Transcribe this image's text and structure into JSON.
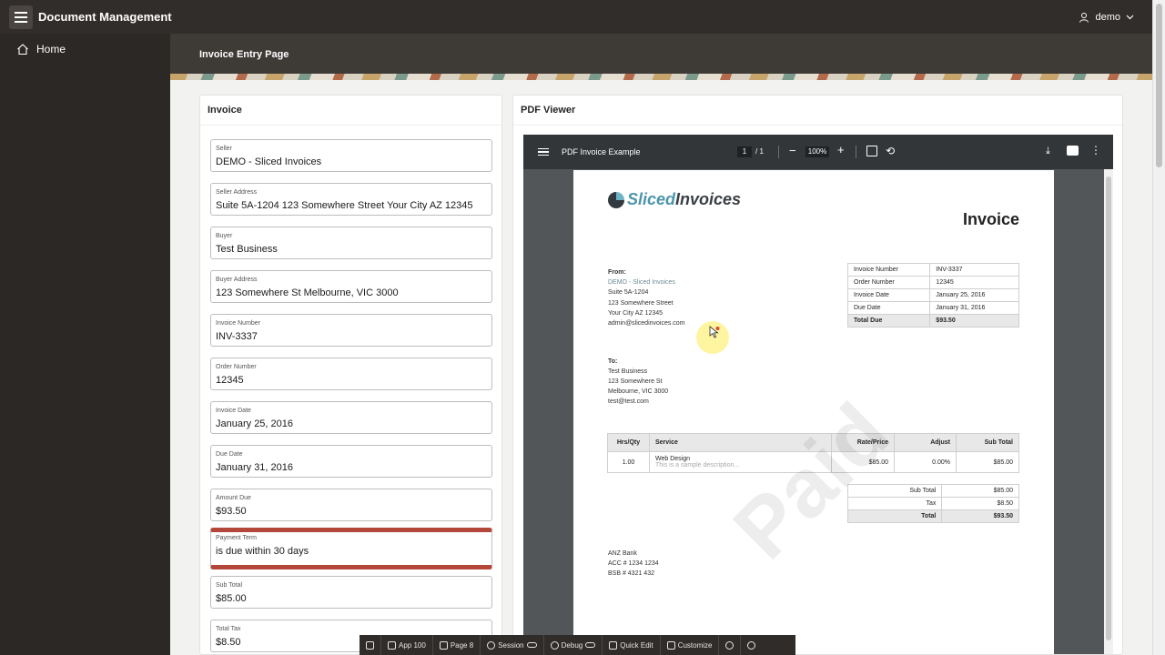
{
  "header": {
    "app_title": "Document Management",
    "user_name": "demo"
  },
  "sidebar": {
    "items": [
      {
        "label": "Home"
      }
    ]
  },
  "page": {
    "title": "Invoice Entry Page"
  },
  "invoice_region": {
    "title": "Invoice",
    "fields": [
      {
        "label": "Seller",
        "value": "DEMO - Sliced Invoices"
      },
      {
        "label": "Seller Address",
        "value": "Suite 5A-1204 123 Somewhere Street Your City AZ 12345"
      },
      {
        "label": "Buyer",
        "value": "Test Business"
      },
      {
        "label": "Buyer Address",
        "value": "123 Somewhere St Melbourne, VIC 3000"
      },
      {
        "label": "Invoice Number",
        "value": "INV-3337"
      },
      {
        "label": "Order Number",
        "value": "12345"
      },
      {
        "label": "Invoice Date",
        "value": "January 25, 2016"
      },
      {
        "label": "Due Date",
        "value": "January 31, 2016"
      },
      {
        "label": "Amount Due",
        "value": "$93.50"
      },
      {
        "label": "Payment Term",
        "value": "is due within 30 days"
      },
      {
        "label": "Sub Total",
        "value": "$85.00"
      },
      {
        "label": "Total Tax",
        "value": "$8.50"
      }
    ]
  },
  "pdf_region": {
    "title": "PDF Viewer",
    "toolbar": {
      "doc_title": "PDF Invoice Example",
      "page_current": "1",
      "page_total": "/ 1",
      "zoom": "100%"
    },
    "document": {
      "logo_part1": "Sliced",
      "logo_part2": "Invoices",
      "heading": "Invoice",
      "from_label": "From:",
      "from_lines": [
        "DEMO - Sliced Invoices",
        "Suite 5A-1204",
        "123 Somewhere Street",
        "Your City AZ 12345",
        "admin@slicedinvoices.com"
      ],
      "to_label": "To:",
      "to_lines": [
        "Test Business",
        "123 Somewhere St",
        "Melbourne, VIC 3000",
        "test@test.com"
      ],
      "meta": [
        {
          "k": "Invoice Number",
          "v": "INV-3337"
        },
        {
          "k": "Order Number",
          "v": "12345"
        },
        {
          "k": "Invoice Date",
          "v": "January 25, 2016"
        },
        {
          "k": "Due Date",
          "v": "January 31, 2016"
        },
        {
          "k": "Total Due",
          "v": "$93.50"
        }
      ],
      "items_header": {
        "qty": "Hrs/Qty",
        "service": "Service",
        "rate": "Rate/Price",
        "adjust": "Adjust",
        "subtotal": "Sub Total"
      },
      "items": [
        {
          "qty": "1.00",
          "service": "Web Design",
          "desc": "This is a sample description...",
          "rate": "$85.00",
          "adjust": "0.00%",
          "subtotal": "$85.00"
        }
      ],
      "totals": [
        {
          "k": "Sub Total",
          "v": "$85.00"
        },
        {
          "k": "Tax",
          "v": "$8.50"
        },
        {
          "k": "Total",
          "v": "$93.50"
        }
      ],
      "bank_lines": [
        "ANZ Bank",
        "ACC # 1234 1234",
        "BSB # 4321 432"
      ],
      "watermark": "Paid"
    }
  },
  "dev_toolbar": {
    "app": "App 100",
    "page": "Page 8",
    "session": "Session",
    "debug": "Debug",
    "quick_edit": "Quick Edit",
    "customize": "Customize"
  }
}
